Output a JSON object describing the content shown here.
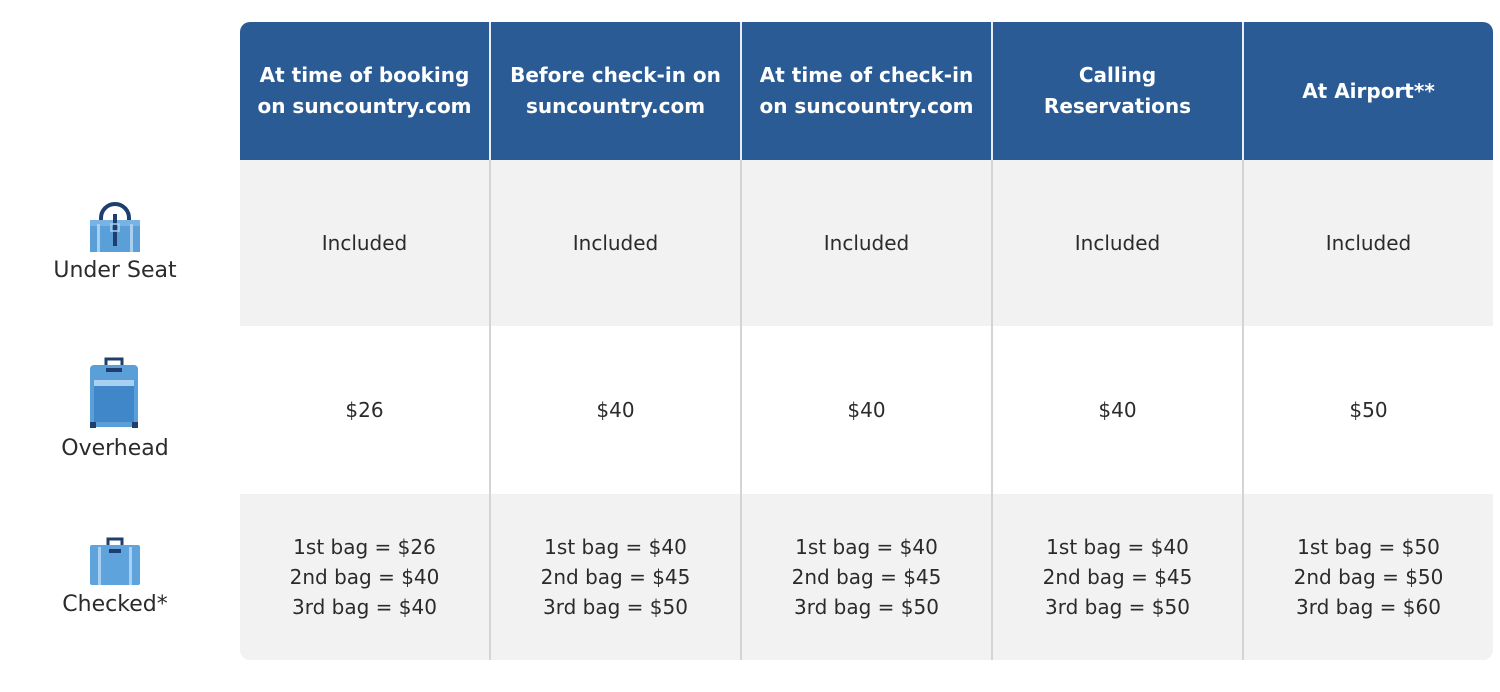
{
  "columns": [
    "At time of booking on suncountry.com",
    "Before check-in on suncountry.com",
    "At time of check-in on suncountry.com",
    "Calling Reservations",
    "At Airport**"
  ],
  "rows": [
    {
      "label": "Under Seat",
      "icon": "personal-bag-icon",
      "cells": [
        [
          "Included"
        ],
        [
          "Included"
        ],
        [
          "Included"
        ],
        [
          "Included"
        ],
        [
          "Included"
        ]
      ]
    },
    {
      "label": "Overhead",
      "icon": "carry-on-suitcase-icon",
      "cells": [
        [
          "$26"
        ],
        [
          "$40"
        ],
        [
          "$40"
        ],
        [
          "$40"
        ],
        [
          "$50"
        ]
      ]
    },
    {
      "label": "Checked*",
      "icon": "checked-suitcase-icon",
      "cells": [
        [
          "1st bag = $26",
          "2nd bag = $40",
          "3rd bag = $40"
        ],
        [
          "1st bag = $40",
          "2nd bag = $45",
          "3rd bag = $50"
        ],
        [
          "1st bag = $40",
          "2nd bag = $45",
          "3rd bag = $50"
        ],
        [
          "1st bag = $40",
          "2nd bag = $45",
          "3rd bag = $50"
        ],
        [
          "1st bag = $50",
          "2nd bag = $50",
          "3rd bag = $60"
        ]
      ]
    }
  ],
  "colors": {
    "header": "#2a5b94",
    "icon_light": "#5fa3dc",
    "icon_dark": "#1e3f6e"
  }
}
